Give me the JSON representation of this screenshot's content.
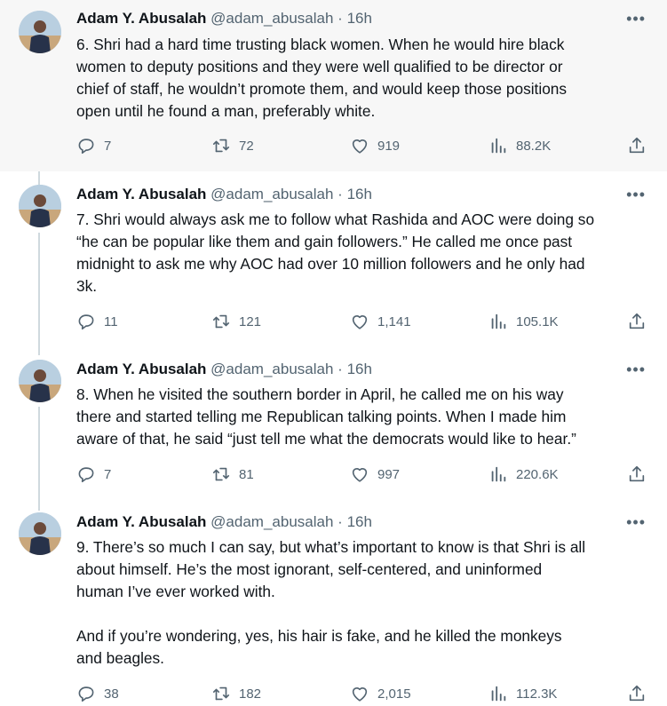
{
  "author": {
    "name": "Adam Y. Abusalah",
    "handle": "@adam_abusalah",
    "separator": "·",
    "time": "16h"
  },
  "tweets": [
    {
      "text": "6. Shri had a hard time trusting black women. When he would hire black\nwomen to deputy positions and they were well qualified to be director or\nchief of staff, he wouldn’t promote them, and would keep those positions\nopen until he found a man, preferably white.",
      "replies": "7",
      "retweets": "72",
      "likes": "919",
      "views": "88.2K"
    },
    {
      "text": "7. Shri would always ask me to follow what Rashida and AOC were doing so\n“he can be popular like them and gain followers.” He called me once past\nmidnight to ask me why AOC had over 10 million followers and he only had\n3k.",
      "replies": "11",
      "retweets": "121",
      "likes": "1,141",
      "views": "105.1K"
    },
    {
      "text": "8. When he visited the southern border in April, he called me on his way\nthere and started telling me Republican talking points. When I made him\naware of that, he said “just tell me what the democrats would like to hear.”",
      "replies": "7",
      "retweets": "81",
      "likes": "997",
      "views": "220.6K"
    },
    {
      "text": "9. There’s so much I can say, but what’s important to know is that Shri is all\nabout himself. He’s the most ignorant, self-centered, and uninformed\nhuman I’ve ever worked with.\n\nAnd if you’re wondering, yes, his hair is fake, and he killed the monkeys\nand beagles.",
      "replies": "38",
      "retweets": "182",
      "likes": "2,015",
      "views": "112.3K"
    }
  ],
  "colors": {
    "muted": "#536471",
    "text": "#0f1419",
    "thread_line": "#cfd9de",
    "highlight_bg": "#f7f7f7"
  },
  "icons": [
    "reply-icon",
    "retweet-icon",
    "heart-icon",
    "views-icon",
    "share-icon",
    "more-icon"
  ]
}
